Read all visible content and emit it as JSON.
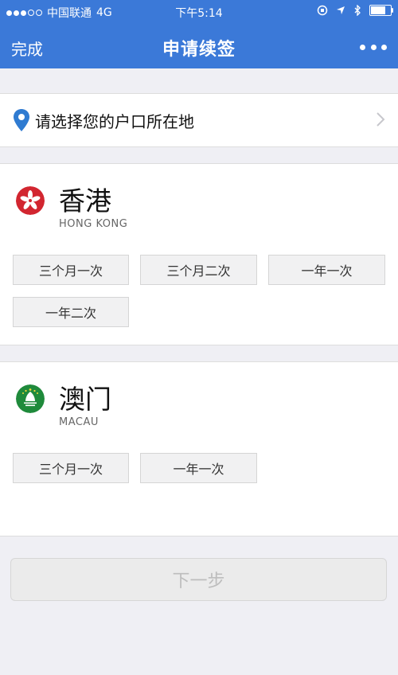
{
  "status_bar": {
    "carrier": "中国联通",
    "network": "4G",
    "time": "下午5:14"
  },
  "nav": {
    "done_label": "完成",
    "title": "申请续签"
  },
  "location": {
    "label": "请选择您的户口所在地"
  },
  "regions": [
    {
      "name": "香港",
      "name_en": "HONG KONG",
      "options": [
        "三个月一次",
        "三个月二次",
        "一年一次",
        "一年二次"
      ]
    },
    {
      "name": "澳门",
      "name_en": "MACAU",
      "options": [
        "三个月一次",
        "一年一次"
      ]
    }
  ],
  "next_button": {
    "label": "下一步"
  },
  "colors": {
    "header_bg": "#3b79d8",
    "hk_flag": "#d22630",
    "macau_flag": "#1f8a3b",
    "pin": "#2f7bd1"
  }
}
